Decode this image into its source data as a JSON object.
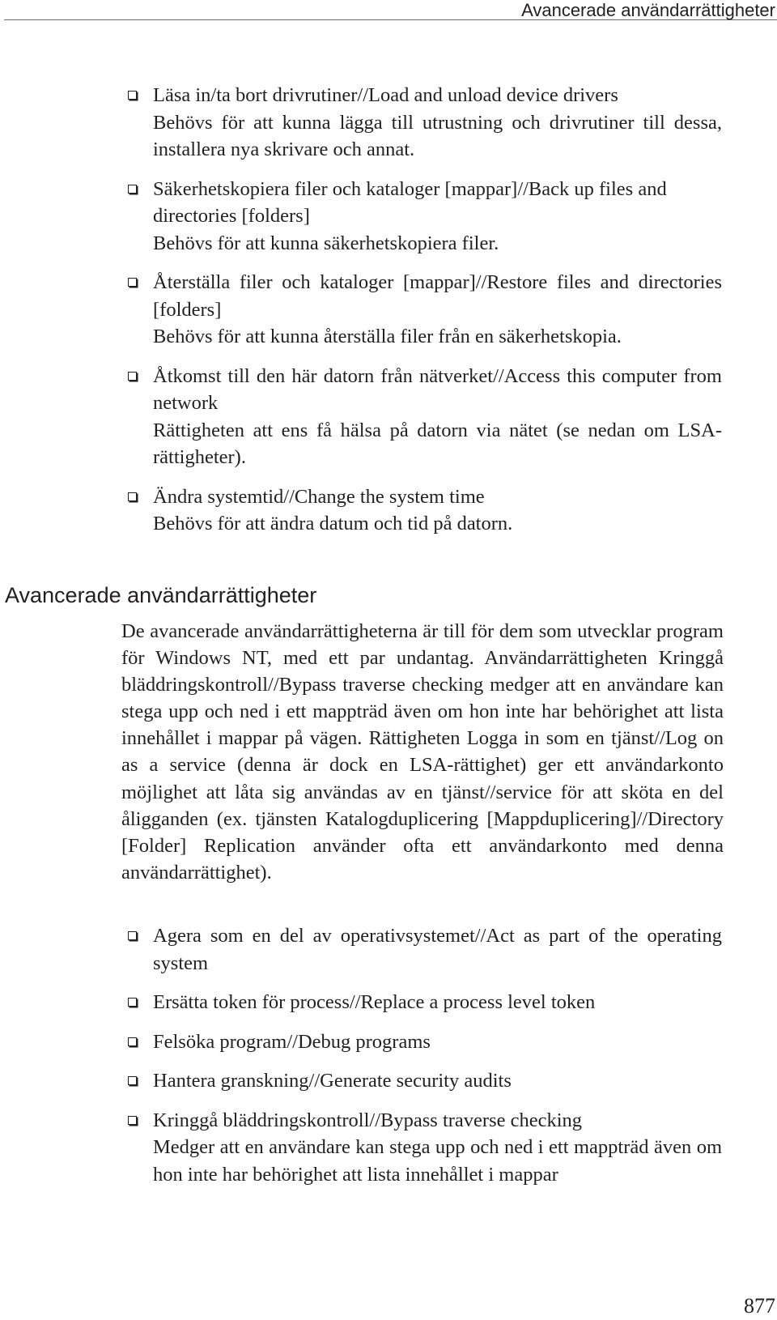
{
  "header": {
    "running_title": "Avancerade användarrättigheter"
  },
  "rights_list_1": [
    {
      "title": "Läsa in/ta bort drivrutiner//Load and unload device drivers",
      "description": "Behövs för att kunna lägga till utrustning och drivrutiner till dessa, installera nya skrivare och annat."
    },
    {
      "title": "Säkerhetskopiera filer och kataloger [mappar]//Back up files and directories [folders]",
      "description": "Behövs för att kunna säkerhetskopiera filer."
    },
    {
      "title": "Återställa filer och kataloger [mappar]//Restore files and directories [folders]",
      "description": "Behövs för att kunna återställa filer från en säkerhetskopia."
    },
    {
      "title": "Åtkomst till den här datorn från nätverket//Access this computer from network",
      "description": "Rättigheten att ens få hälsa på datorn via nätet (se nedan om LSA-rättigheter)."
    },
    {
      "title": "Ändra systemtid//Change the system time",
      "description": "Behövs för att ändra datum och tid på datorn."
    }
  ],
  "section": {
    "heading": "Avancerade användarrättigheter",
    "paragraph": "De avancerade användarrättigheterna är till för dem som utvecklar program för Windows NT, med ett par undantag. Användarrättigheten Kringgå bläddringskontroll//Bypass traverse checking medger att en användare kan stega upp och ned i ett mappträd även om hon inte har behörighet att lista innehållet i mappar på vägen. Rättigheten Logga in som en tjänst//Log on as a service (denna är dock en LSA-rättighet) ger ett användar­konto möjlighet att låta sig användas av en tjänst//service för att sköta en del åligganden (ex. tjänsten Katalogduplicering [Mappduplicering]//Directory [Folder] Replication använder ofta ett användarkonto med denna användarrättighet)."
  },
  "rights_list_2": [
    {
      "title": "Agera som en del av operativsystemet//Act as part of the operating system",
      "description": ""
    },
    {
      "title": "Ersätta token för process//Replace a process level token",
      "description": ""
    },
    {
      "title": "Felsöka program//Debug programs",
      "description": ""
    },
    {
      "title": "Hantera granskning//Generate security audits",
      "description": ""
    },
    {
      "title": "Kringgå bläddringskontroll//Bypass traverse checking",
      "description": "Medger att en användare kan stega upp och ned i ett mappträd även om hon inte har behörighet att lista innehållet i mappar"
    }
  ],
  "footer": {
    "page_number": "877"
  },
  "icons": {
    "bullet": "checkbox-square-icon"
  }
}
